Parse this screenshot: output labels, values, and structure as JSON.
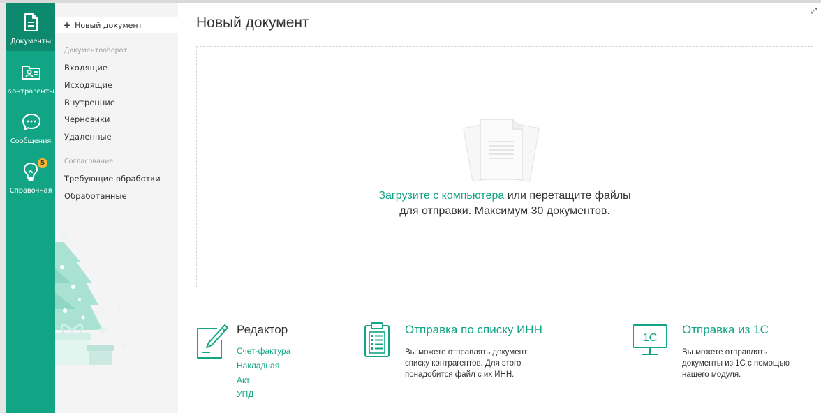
{
  "rail": {
    "items": [
      {
        "label": "Документы",
        "icon": "document-icon",
        "active": true
      },
      {
        "label": "Контрагенты",
        "icon": "contacts-folder-icon",
        "active": false
      },
      {
        "label": "Сообщения",
        "icon": "chat-bubble-icon",
        "active": false
      },
      {
        "label": "Справочная",
        "icon": "lightbulb-icon",
        "active": false,
        "badge": "5"
      }
    ]
  },
  "sidebar": {
    "new_document": "Новый документ",
    "sections": [
      {
        "title": "Документооборот",
        "items": [
          "Входящие",
          "Исходящие",
          "Внутренние",
          "Черновики",
          "Удаленные"
        ]
      },
      {
        "title": "Согласование",
        "items": [
          "Требующие обработки",
          "Обработанные"
        ]
      }
    ]
  },
  "main": {
    "title": "Новый документ",
    "dropzone": {
      "link": "Загрузите с компьютера",
      "text_after_link": " или перетащите файлы",
      "line2": "для отправки. Максимум 30 документов."
    },
    "features": [
      {
        "title": "Редактор",
        "icon": "pencil-edit-icon",
        "links": [
          "Счет-фактура",
          "Накладная",
          "Акт",
          "УПД"
        ]
      },
      {
        "title": "Отправка по списку ИНН",
        "icon": "clipboard-list-icon",
        "description": "Вы можете отправлять документ списку контрагентов. Для этого понадобится файл с их ИНН."
      },
      {
        "title": "Отправка из 1С",
        "icon": "monitor-1c-icon",
        "icon_text": "1С",
        "description": "Вы можете отправлять документы из 1С с помощью нашего модуля."
      }
    ]
  },
  "colors": {
    "accent": "#12a585",
    "rail_active": "#0d8a6e",
    "badge": "#f5b82e",
    "sidebar_bg": "#f4f4f4"
  }
}
